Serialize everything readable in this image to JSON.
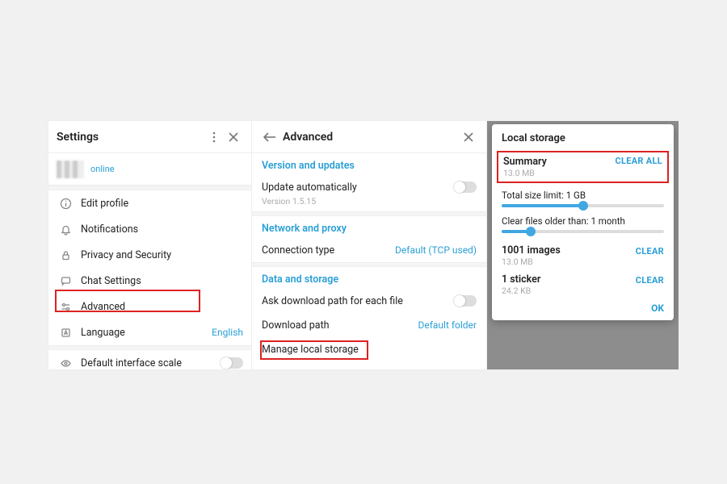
{
  "panel1": {
    "title": "Settings",
    "status": "online",
    "items": [
      {
        "label": "Edit profile"
      },
      {
        "label": "Notifications"
      },
      {
        "label": "Privacy and Security"
      },
      {
        "label": "Chat Settings"
      },
      {
        "label": "Advanced"
      },
      {
        "label": "Language",
        "value": "English"
      }
    ],
    "scale_row": {
      "label": "Default interface scale"
    }
  },
  "panel2": {
    "title": "Advanced",
    "sections": {
      "version": {
        "heading": "Version and updates",
        "update_label": "Update automatically",
        "update_sub": "Version 1.5.15"
      },
      "network": {
        "heading": "Network and proxy",
        "conn_label": "Connection type",
        "conn_value": "Default (TCP used)"
      },
      "data": {
        "heading": "Data and storage",
        "ask_label": "Ask download path for each file",
        "path_label": "Download path",
        "path_value": "Default folder",
        "manage_label": "Manage local storage"
      }
    }
  },
  "panel3": {
    "title": "Local storage",
    "summary": {
      "label": "Summary",
      "size": "13.0 MB",
      "action": "CLEAR ALL"
    },
    "size_limit": {
      "label": "Total size limit: 1 GB",
      "pct": 50
    },
    "older_than": {
      "label": "Clear files older than: 1 month",
      "pct": 18
    },
    "items": [
      {
        "label": "1001 images",
        "size": "13.0 MB",
        "action": "CLEAR"
      },
      {
        "label": "1 sticker",
        "size": "24.2 KB",
        "action": "CLEAR"
      }
    ],
    "ok": "OK"
  }
}
